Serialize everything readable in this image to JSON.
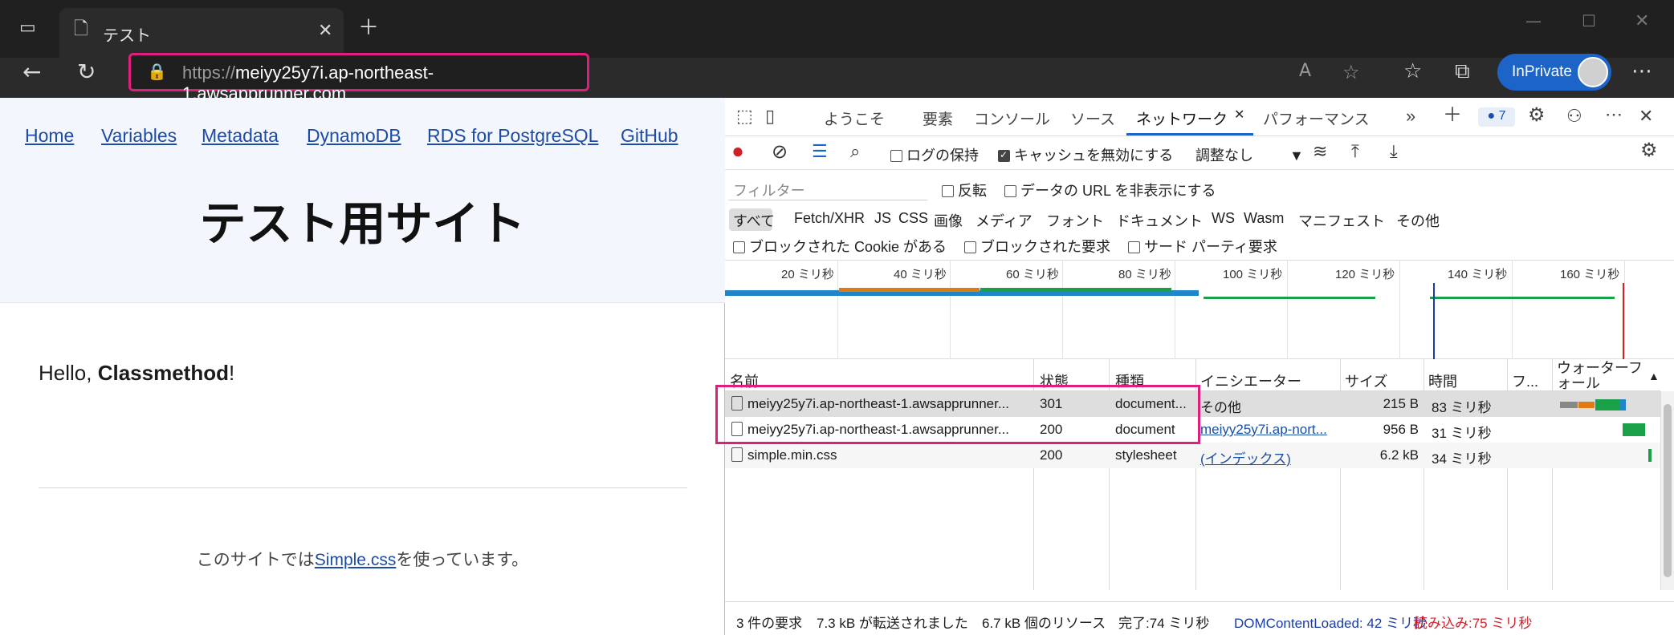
{
  "browser": {
    "tab_title": "テスト",
    "url_prefix": "https://",
    "url_host": "meiyy25y7i.ap-northeast-1.awsapprunner.com",
    "inprivate_label": "InPrivate"
  },
  "site": {
    "nav": [
      "Home",
      "Variables",
      "Metadata",
      "DynamoDB",
      "RDS for PostgreSQL",
      "GitHub"
    ],
    "title": "テスト用サイト",
    "hello_prefix": "Hello, ",
    "hello_name": "Classmethod",
    "hello_suffix": "!",
    "footer_prefix": "このサイトでは",
    "footer_link": "Simple.css",
    "footer_suffix": "を使っています。"
  },
  "devtools": {
    "tabs": [
      "ようこそ",
      "要素",
      "コンソール",
      "ソース",
      "ネットワーク",
      "パフォーマンス"
    ],
    "active_tab": "ネットワーク",
    "issue_count": "7",
    "preserve_log": "ログの保持",
    "disable_cache": "キャッシュを無効にする",
    "throttle": "調整なし",
    "filter_placeholder": "フィルター",
    "invert": "反転",
    "hide_data_urls": "データの URL を非表示にする",
    "filter_types": [
      "すべて",
      "Fetch/XHR",
      "JS",
      "CSS",
      "画像",
      "メディア",
      "フォント",
      "ドキュメント",
      "WS",
      "Wasm",
      "マニフェスト",
      "その他"
    ],
    "blocked_cookies": "ブロックされた Cookie がある",
    "blocked_requests": "ブロックされた要求",
    "third_party": "サード パーティ要求",
    "timeline_ticks": [
      "20 ミリ秒",
      "40 ミリ秒",
      "60 ミリ秒",
      "80 ミリ秒",
      "100 ミリ秒",
      "120 ミリ秒",
      "140 ミリ秒",
      "160 ミリ秒"
    ],
    "columns": [
      "名前",
      "状態",
      "種類",
      "イニシエーター",
      "サイズ",
      "時間",
      "フ...",
      "ウォーターフォール"
    ],
    "rows": [
      {
        "name": "meiyy25y7i.ap-northeast-1.awsapprunner...",
        "status": "301",
        "type": "document...",
        "initiator": "その他",
        "size": "215 B",
        "time": "83 ミリ秒"
      },
      {
        "name": "meiyy25y7i.ap-northeast-1.awsapprunner...",
        "status": "200",
        "type": "document",
        "initiator": "meiyy25y7i.ap-nort...",
        "size": "956 B",
        "time": "31 ミリ秒"
      },
      {
        "name": "simple.min.css",
        "status": "200",
        "type": "stylesheet",
        "initiator": "(インデックス)",
        "size": "6.2 kB",
        "time": "34 ミリ秒"
      }
    ],
    "status_bar": {
      "requests": "3 件の要求",
      "transferred": "7.3 kB が転送されました",
      "resources": "6.7 kB 個のリソース",
      "finish": "完了:74 ミリ秒",
      "dcl": "DOMContentLoaded: 42 ミリ秒",
      "load": "読み込み:75 ミリ秒"
    }
  },
  "colors": {
    "highlight": "#e01e7d",
    "dcl": "#1a3ca8",
    "load": "#d0202a",
    "inprivate": "#1c64c7"
  }
}
